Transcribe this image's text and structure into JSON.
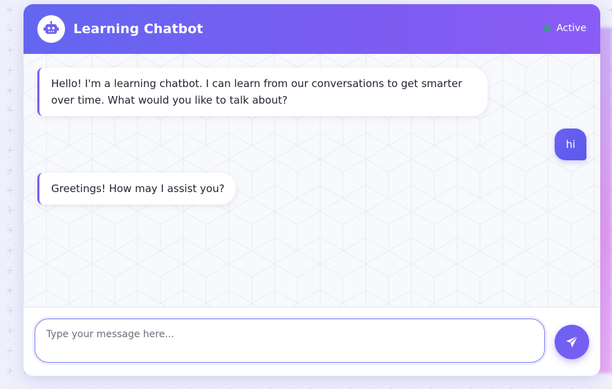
{
  "colors": {
    "header_start": "#6366f1",
    "header_end": "#8b5cf6",
    "status_dot": "#3b9b8f",
    "bot_accent": "#7c5cf2",
    "user_bubble": "#5b58ea"
  },
  "header": {
    "title": "Learning Chatbot",
    "avatar_icon": "robot-icon",
    "status_label": "Active"
  },
  "messages": [
    {
      "sender": "bot",
      "text": "Hello! I'm a learning chatbot. I can learn from our conversations to get smarter over time. What would you like to talk about?"
    },
    {
      "sender": "user",
      "text": "hi"
    },
    {
      "sender": "bot",
      "text": "Greetings! How may I assist you?"
    }
  ],
  "composer": {
    "placeholder": "Type your message here...",
    "value": "",
    "send_icon": "paper-plane-icon"
  }
}
